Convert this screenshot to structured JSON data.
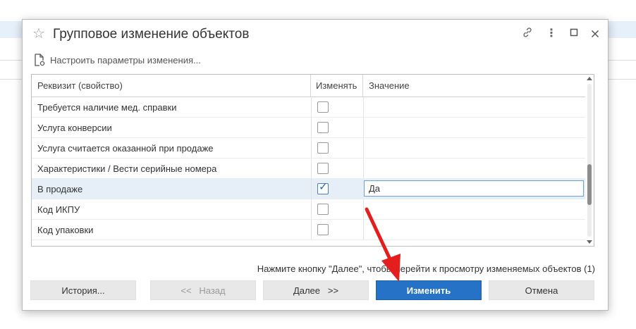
{
  "dialog": {
    "title": "Групповое изменение объектов",
    "settings_link": "Настроить параметры изменения..."
  },
  "table": {
    "headers": [
      "Реквизит (свойство)",
      "Изменять",
      "Значение"
    ],
    "rows": [
      {
        "name": "Требуется наличие мед. справки",
        "change": false,
        "value": ""
      },
      {
        "name": "Услуга конверсии",
        "change": false,
        "value": ""
      },
      {
        "name": "Услуга считается оказанной при продаже",
        "change": false,
        "value": ""
      },
      {
        "name": "Характеристики / Вести серийные номера",
        "change": false,
        "value": ""
      },
      {
        "name": "В продаже",
        "change": true,
        "value": "Да"
      },
      {
        "name": "Код ИКПУ",
        "change": false,
        "value": ""
      },
      {
        "name": "Код упаковки",
        "change": false,
        "value": ""
      }
    ],
    "scroll_position": 0.72
  },
  "hint": "Нажмите кнопку \"Далее\", чтобы перейти к просмотру изменяемых объектов (1)",
  "buttons": {
    "history": "История...",
    "back": "<<   Назад",
    "next": "Далее   >>",
    "apply": "Изменить",
    "cancel": "Отмена"
  },
  "icons": {
    "star": "star-icon",
    "link": "link-icon",
    "more": "more-icon",
    "maximize": "maximize-icon",
    "close": "close-icon",
    "settings": "document-settings-icon"
  },
  "colors": {
    "primary": "#2672c7",
    "selected_row": "#e6eef8",
    "arrow": "#e41e1e"
  }
}
